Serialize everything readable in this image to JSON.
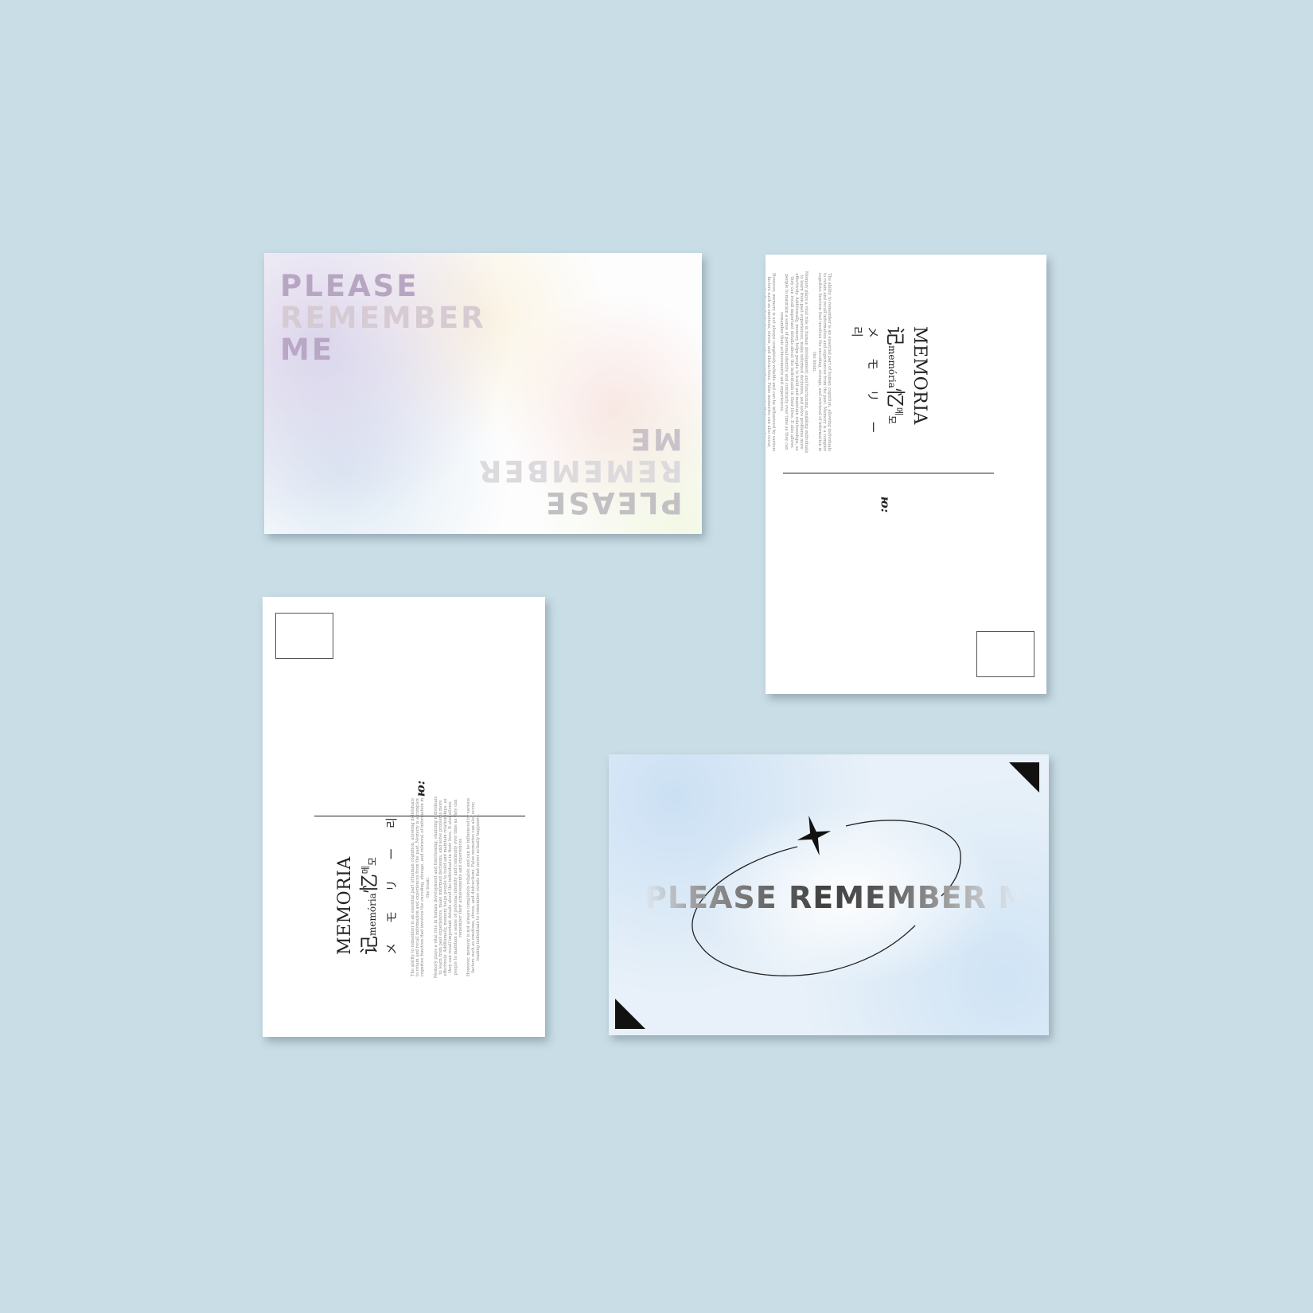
{
  "colors": {
    "background": "#c9dde6",
    "card": "#ffffff",
    "ink": "#222222"
  },
  "cards": {
    "front_gradient": {
      "lines": [
        "PLEASE",
        "REMEMBER",
        "ME"
      ]
    },
    "back": {
      "title": "MEMORIA",
      "chinese_1": "记",
      "latin": "memória",
      "chinese_2": "忆",
      "korean_1": "메",
      "korean_2": "모",
      "katakana": "メ モ リ ー",
      "korean_3": "리",
      "to_label": "ю:",
      "paragraph_1": "The ability to remember is an essential part of human cognition, allowing individuals to retain and recall information and experiences from the past. Memory is a complex cognitive function that involves the encoding, storage, and retrieval of information in the brain.",
      "paragraph_2": "Memory plays a vital role in human development and functioning, enabling individuals to learn from past experiences, make informed decisions, and solve problems more effectively. Additionally, memory helps people to build and maintain relationships, as they can recall important details about the individuals in their lives. It also allows people to maintain a sense of personal identity and continuity over time as they can remember their achievements and experiences.",
      "paragraph_3": "However, memory is not always completely reliable and can be influenced by various factors such as emotions, stress, and distractions. False memories can also occur, leading individuals to remember events that never actually happened."
    },
    "front_blue": {
      "text": "PLEASE REMEMBER ME",
      "icon": "four-point-star-icon"
    }
  }
}
